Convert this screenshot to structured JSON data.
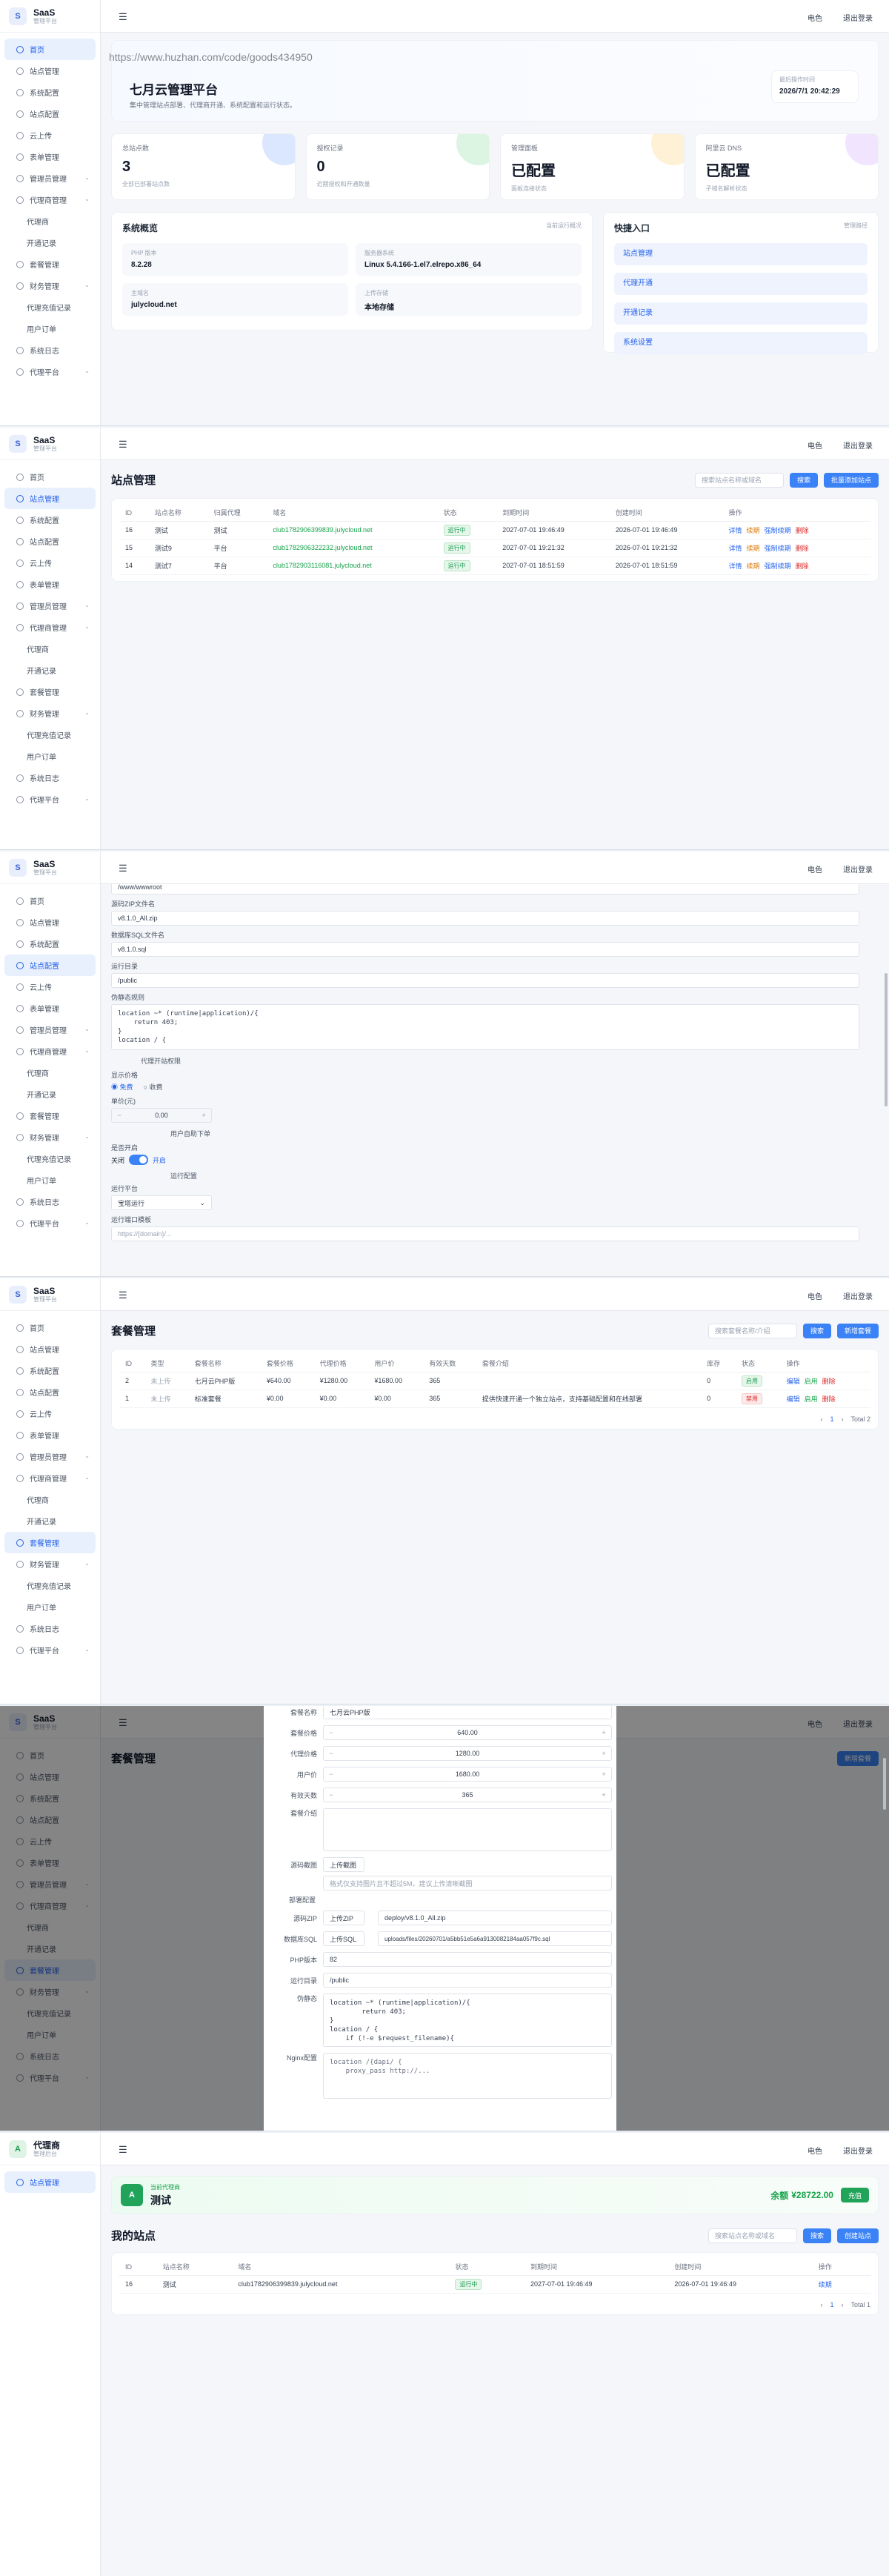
{
  "brand": {
    "name": "SaaS",
    "subtitle": "管理平台"
  },
  "topbar": {
    "notify": "电色",
    "logout": "退出登录"
  },
  "menu": [
    {
      "label": "首页",
      "sub": false,
      "caret": false
    },
    {
      "label": "站点管理",
      "sub": false,
      "caret": false
    },
    {
      "label": "系统配置",
      "sub": false,
      "caret": false
    },
    {
      "label": "站点配置",
      "sub": false,
      "caret": false
    },
    {
      "label": "云上传",
      "sub": false,
      "caret": false
    },
    {
      "label": "表单管理",
      "sub": false,
      "caret": false
    },
    {
      "label": "管理员管理",
      "sub": false,
      "caret": true
    },
    {
      "label": "代理商管理",
      "sub": false,
      "caret": true
    },
    {
      "label": "代理商",
      "sub": true,
      "caret": false
    },
    {
      "label": "开通记录",
      "sub": true,
      "caret": false
    },
    {
      "label": "套餐管理",
      "sub": false,
      "caret": false
    },
    {
      "label": "财务管理",
      "sub": false,
      "caret": true
    },
    {
      "label": "代理充值记录",
      "sub": true,
      "caret": false
    },
    {
      "label": "用户订单",
      "sub": true,
      "caret": false
    },
    {
      "label": "系统日志",
      "sub": false,
      "caret": false
    },
    {
      "label": "代理平台",
      "sub": false,
      "caret": true
    }
  ],
  "dashboard": {
    "watermark": "https://www.huzhan.com/code/goods434950",
    "welcome_title": "七月云管理平台",
    "welcome_sub": "集中管理站点部署、代理商开通、系统配置和运行状态。",
    "time_label": "最后操作时间",
    "time_value": "2026/7/1 20:42:29",
    "stats": [
      {
        "label": "总站点数",
        "value": "3",
        "desc": "全部已部署站点数",
        "color": "#dbe6ff"
      },
      {
        "label": "授权记录",
        "value": "0",
        "desc": "近期授权和开通数量",
        "color": "#dcf5e3"
      },
      {
        "label": "管理面板",
        "value": "已配置",
        "desc": "面板连接状态",
        "color": "#fff1d6"
      },
      {
        "label": "阿里云 DNS",
        "value": "已配置",
        "desc": "子域名解析状态",
        "color": "#f1e4ff"
      }
    ],
    "overview_title": "系统概览",
    "overview_link": "当前运行概况",
    "overview": [
      {
        "label": "PHP 版本",
        "value": "8.2.28"
      },
      {
        "label": "服务器系统",
        "value": "Linux 5.4.166-1.el7.elrepo.x86_64"
      },
      {
        "label": "主域名",
        "value": "julycloud.net"
      },
      {
        "label": "上传存储",
        "value": "本地存储"
      }
    ],
    "quick_title": "快捷入口",
    "quick_link": "管理路径",
    "quick": [
      "站点管理",
      "代理开通",
      "开通记录",
      "系统设置"
    ]
  },
  "sites": {
    "title": "站点管理",
    "search_placeholder": "搜索站点名称或域名",
    "search_btn": "搜索",
    "add_btn": "批量添加站点",
    "columns": [
      "ID",
      "站点名称",
      "归属代理",
      "域名",
      "状态",
      "到期时间",
      "创建时间",
      "操作"
    ],
    "rows": [
      {
        "id": "16",
        "name": "测试",
        "agent": "测试",
        "domain": "club1782906399839.julycloud.net",
        "status": "运行中",
        "expire": "2027-07-01 19:46:49",
        "created": "2026-07-01 19:46:49"
      },
      {
        "id": "15",
        "name": "测试9",
        "agent": "平台",
        "domain": "club1782906322232.julycloud.net",
        "status": "运行中",
        "expire": "2027-07-01 19:21:32",
        "created": "2026-07-01 19:21:32"
      },
      {
        "id": "14",
        "name": "测试7",
        "agent": "平台",
        "domain": "club1782903116081.julycloud.net",
        "status": "运行中",
        "expire": "2027-07-01 18:51:59",
        "created": "2026-07-01 18:51:59"
      }
    ],
    "actions": [
      "详情",
      "续期",
      "强制续期",
      "删除"
    ]
  },
  "edit_form": {
    "f0": "/www/wwwroot",
    "zip_label": "源码ZIP文件名",
    "zip_value": "v8.1.0_All.zip",
    "sql_label": "数据库SQL文件名",
    "sql_value": "v8.1.0.sql",
    "run_label": "运行目录",
    "run_value": "/public",
    "pseudo_label": "伪静态规则",
    "pseudo_value": "location ~* (runtime|application)/{\n    return 403;\n}\nlocation / {",
    "agent_section": "代理开站权限",
    "show_label": "显示价格",
    "radio_a": "免费",
    "radio_b": "收费",
    "price_label": "单价(元)",
    "price_value": "0.00",
    "user_section": "用户自助下单",
    "enable_label": "是否开启",
    "toggle_off": "关闭",
    "toggle_on": "开启",
    "run_section": "运行配置",
    "platform_label": "运行平台",
    "platform_value": "宝塔运行",
    "url_label": "运行端口模板",
    "url_value": "https://{domain}/..."
  },
  "packages": {
    "title": "套餐管理",
    "search_placeholder": "搜索套餐名称/介绍",
    "search_btn": "搜索",
    "add_btn": "新增套餐",
    "columns": [
      "ID",
      "类型",
      "套餐名称",
      "套餐价格",
      "代理价格",
      "用户价",
      "有效天数",
      "套餐介绍",
      "库存",
      "状态",
      "操作"
    ],
    "rows": [
      {
        "id": "2",
        "type": "未上传",
        "name": "七月云PHP版",
        "price": "¥640.00",
        "agent": "¥1280.00",
        "user": "¥1680.00",
        "days": "365",
        "desc": "",
        "stock": "0",
        "status": "启用"
      },
      {
        "id": "1",
        "type": "未上传",
        "name": "标准套餐",
        "price": "¥0.00",
        "agent": "¥0.00",
        "user": "¥0.00",
        "days": "365",
        "desc": "提供快速开通一个独立站点，支持基础配置和在线部署",
        "stock": "0",
        "status": "禁用"
      }
    ],
    "actions": [
      "编辑",
      "启用",
      "删除"
    ],
    "page": "1",
    "total": "Total 2"
  },
  "pkg_modal": {
    "name_label": "套餐名称",
    "name_value": "七月云PHP版",
    "fields": [
      {
        "label": "套餐价格",
        "value": "640.00"
      },
      {
        "label": "代理价格",
        "value": "1280.00"
      },
      {
        "label": "用户价",
        "value": "1680.00"
      },
      {
        "label": "有效天数",
        "value": "365"
      }
    ],
    "intro_label": "套餐介绍",
    "cover_label": "源码截图",
    "cover_btn": "上传截图",
    "cover_hint": "格式仅支持图片且不超过5M，建议上传清晰截图",
    "deploy_section": "部署配置",
    "zip_label": "源码ZIP",
    "zip_btn": "上传ZIP",
    "zip_value": "deploy/v8.1.0_All.zip",
    "sql_label": "数据库SQL",
    "sql_btn": "上传SQL",
    "sql_value": "uploads/files/20260701/a5bb51e5a6a9130082184aa057f9c.sql",
    "php_label": "PHP版本",
    "php_value": "82",
    "run_label": "运行目录",
    "run_value": "/public",
    "pseudo_label": "伪静态",
    "pseudo_value": "location ~* (runtime|application)/{\n        return 403;\n}\nlocation / {\n    if (!-e $request_filename){",
    "nginx_label": "Nginx配置",
    "nginx_value": "location /{dapi/ {\n    proxy_pass http://..."
  },
  "agent_brand": {
    "name": "代理商",
    "subtitle": "管理后台"
  },
  "agent_menu": [
    "站点管理"
  ],
  "agent_page": {
    "card_label": "当前代理商",
    "card_name": "测试",
    "balance_label": "余额",
    "balance_value": "¥28722.00",
    "recharge_btn": "充值",
    "title": "我的站点",
    "search_placeholder": "搜索站点名称或域名",
    "search_btn": "搜索",
    "add_btn": "创建站点",
    "columns": [
      "ID",
      "站点名称",
      "域名",
      "状态",
      "到期时间",
      "创建时间",
      "操作"
    ],
    "rows": [
      {
        "id": "16",
        "name": "测试",
        "domain": "club1782906399839.julycloud.net",
        "status": "运行中",
        "expire": "2027-07-01 19:46:49",
        "created": "2026-07-01 19:46:49",
        "op": "续期"
      }
    ],
    "page": "1",
    "total": "Total 1"
  }
}
